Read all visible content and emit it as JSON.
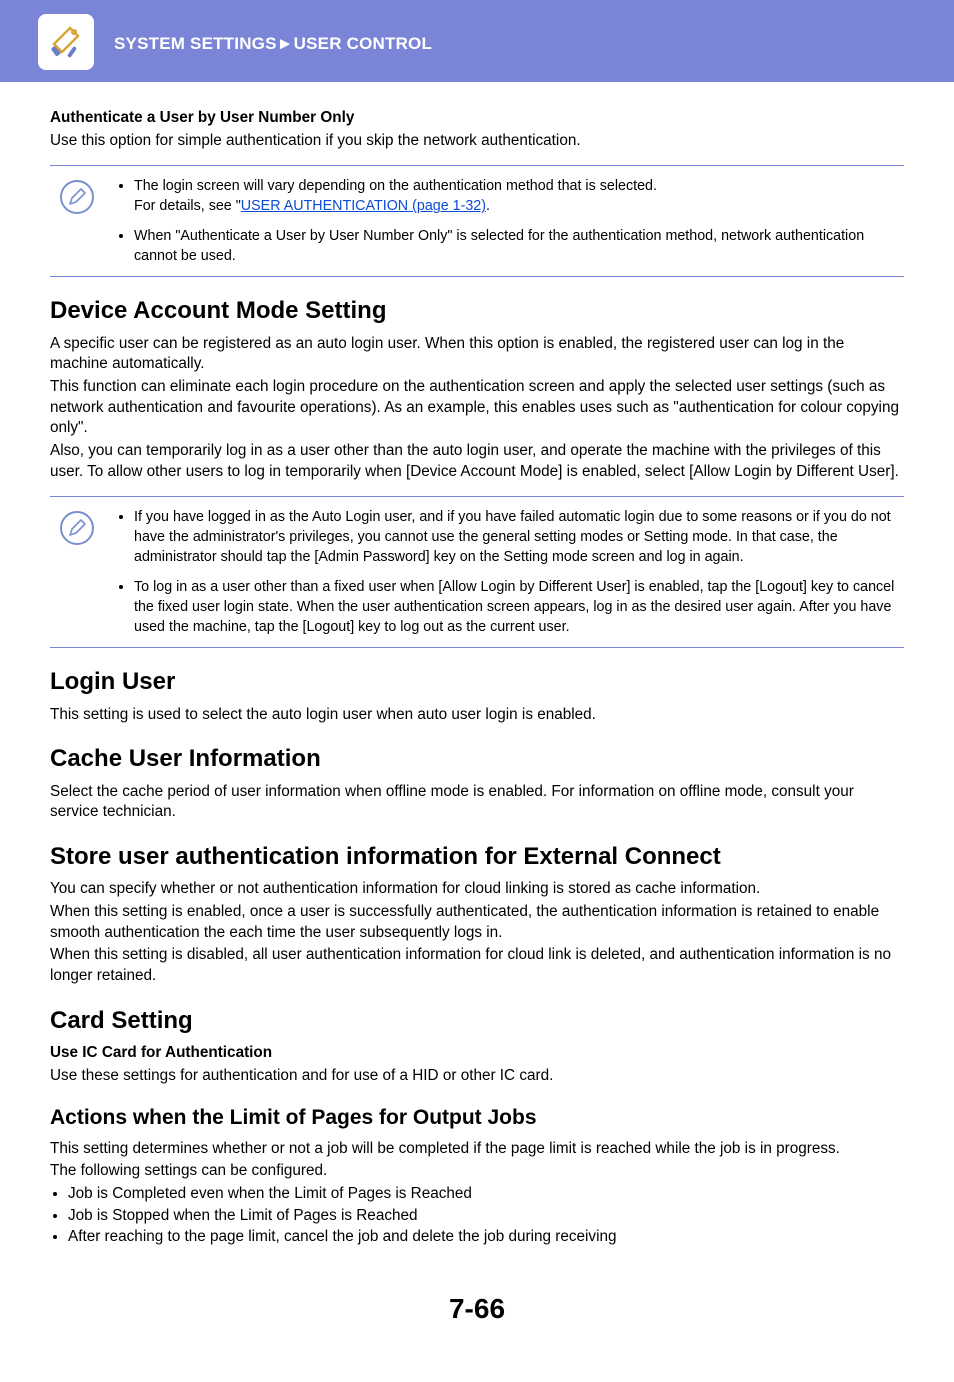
{
  "header": {
    "breadcrumb": "SYSTEM SETTINGS►USER CONTROL",
    "icon_name": "tools-icon"
  },
  "sec_auth_user_number": {
    "title": "Authenticate a User by User Number Only",
    "desc": "Use this option for simple authentication if you skip the network authentication."
  },
  "note1": {
    "items": [
      {
        "pre": "The login screen will vary depending on the authentication method that is selected.\nFor details, see \"",
        "link_text": "USER AUTHENTICATION (page 1-32)",
        "post": "."
      },
      {
        "text": "When \"Authenticate a User by User Number Only\" is selected for the authentication method, network authentication cannot be used."
      }
    ]
  },
  "sec_device_account": {
    "title": "Device Account Mode Setting",
    "p1": "A specific user can be registered as an auto login user. When this option is enabled, the registered user can log in the machine automatically.",
    "p2": "This function can eliminate each login procedure on the authentication screen and apply the selected user settings (such as network authentication and favourite operations). As an example, this enables uses such as \"authentication for colour copying only\".",
    "p3": "Also, you can temporarily log in as a user other than the auto login user, and operate the machine with the privileges of this user. To allow other users to log in temporarily when [Device Account Mode] is enabled, select [Allow Login by Different User]."
  },
  "note2": {
    "items": [
      "If you have logged in as the Auto Login user, and if you have failed automatic login due to some reasons or if you do not have the administrator's privileges, you cannot use the general setting modes or Setting mode. In that case, the administrator should tap the [Admin Password] key on the Setting mode screen and log in again.",
      "To log in as a user other than a fixed user when [Allow Login by Different User] is enabled, tap the [Logout] key to cancel the fixed user login state. When the user authentication screen appears, log in as the desired user again. After you have used the machine, tap the [Logout] key to log out as the current user."
    ]
  },
  "sec_login_user": {
    "title": "Login User",
    "p1": "This setting is used to select the auto login user when auto user login is enabled."
  },
  "sec_cache": {
    "title": "Cache User Information",
    "p1": "Select the cache period of user information when offline mode is enabled. For information on offline mode, consult your service technician."
  },
  "sec_store_ext": {
    "title": "Store user authentication information for External Connect",
    "p1": "You can specify whether or not authentication information for cloud linking is stored as cache information.",
    "p2": "When this setting is enabled, once a user is successfully authenticated, the authentication information is retained to enable smooth authentication the each time the user subsequently logs in.",
    "p3": "When this setting is disabled, all user authentication information for cloud link is deleted, and authentication information is no longer retained."
  },
  "sec_card": {
    "title": "Card Setting",
    "sub": "Use IC Card for Authentication",
    "p1": "Use these settings for authentication and for use of a HID or other IC card."
  },
  "sec_actions": {
    "title": "Actions when the Limit of Pages for Output Jobs",
    "p1": "This setting determines whether or not a job will be completed if the page limit is reached while the job is in progress.",
    "p2": "The following settings can be configured.",
    "options": [
      "Job is Completed even when the Limit of Pages is Reached",
      "Job is Stopped when the Limit of Pages is Reached",
      "After reaching to the page limit, cancel the job and delete the job during receiving"
    ]
  },
  "page_number": "7-66"
}
